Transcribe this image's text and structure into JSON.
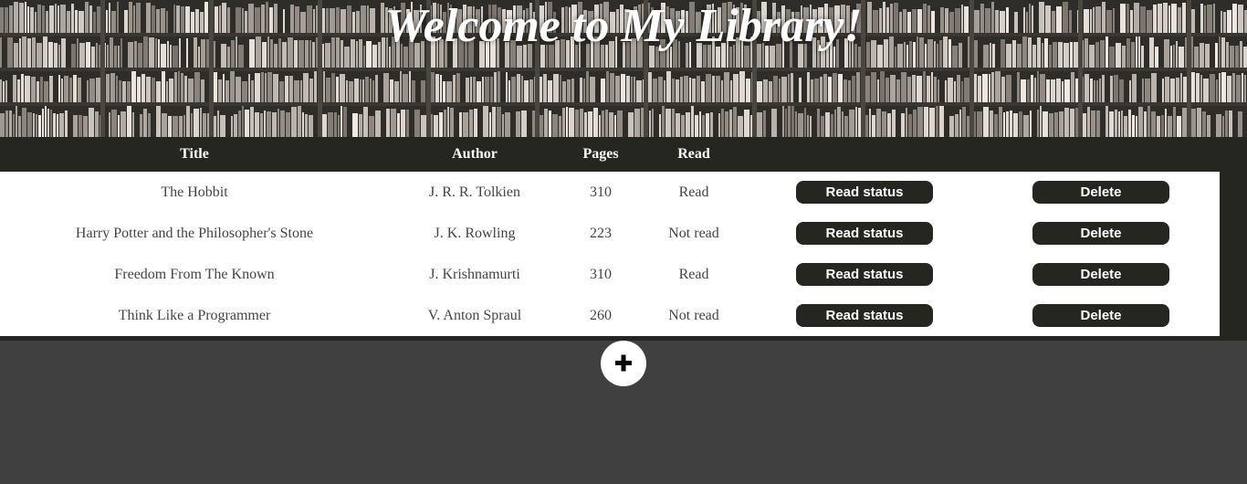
{
  "header": {
    "title": "Welcome to My Library!"
  },
  "table": {
    "columns": [
      "Title",
      "Author",
      "Pages",
      "Read"
    ],
    "rows": [
      {
        "title": "The Hobbit",
        "author": "J. R. R. Tolkien",
        "pages": "310",
        "read": "Read",
        "status_label": "Read status",
        "delete_label": "Delete"
      },
      {
        "title": "Harry Potter and the Philosopher's Stone",
        "author": "J. K. Rowling",
        "pages": "223",
        "read": "Not read",
        "status_label": "Read status",
        "delete_label": "Delete"
      },
      {
        "title": "Freedom From The Known",
        "author": "J. Krishnamurti",
        "pages": "310",
        "read": "Read",
        "status_label": "Read status",
        "delete_label": "Delete"
      },
      {
        "title": "Think Like a Programmer",
        "author": "V. Anton Spraul",
        "pages": "260",
        "read": "Not read",
        "status_label": "Read status",
        "delete_label": "Delete"
      }
    ]
  },
  "add_button": {
    "icon": "plus-icon"
  },
  "colors": {
    "header_bar": "#262621",
    "page_background": "#404040",
    "button_background": "#262621",
    "button_text": "#ffffff",
    "cell_text": "#444444"
  }
}
